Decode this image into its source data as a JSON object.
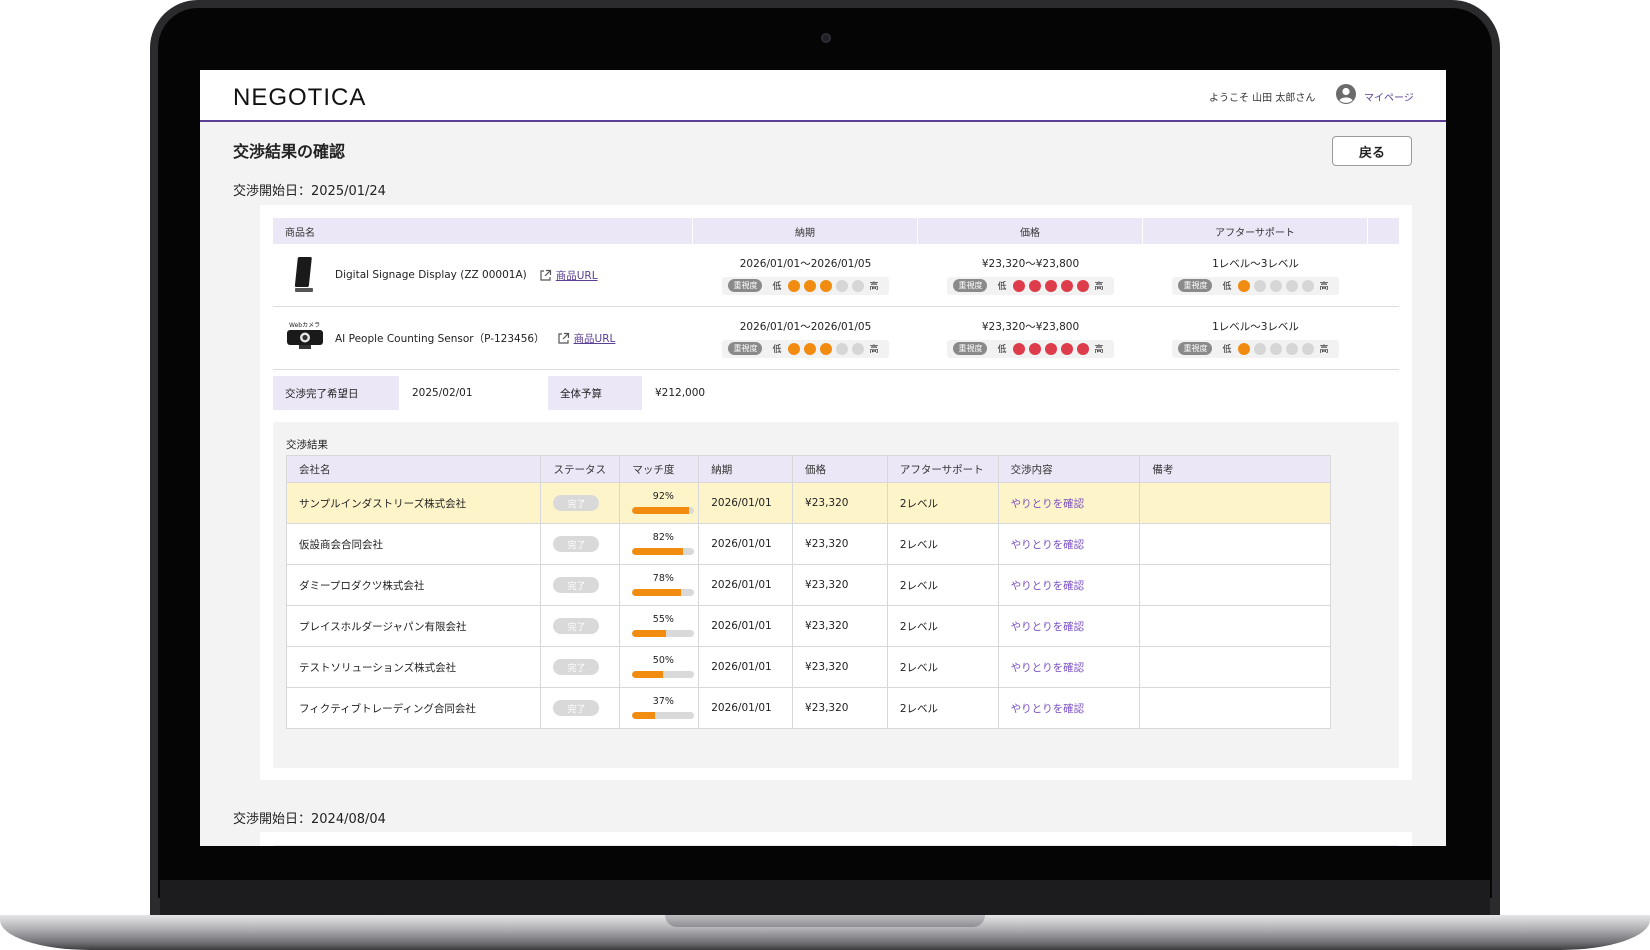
{
  "header": {
    "logo": "NEGOTICA",
    "welcome": "ようこそ 山田 太郎さん",
    "mypage": "マイページ"
  },
  "page": {
    "title": "交渉結果の確認",
    "back": "戻る"
  },
  "sections": [
    {
      "start_date": "交渉開始日：2025/01/24"
    },
    {
      "start_date": "交渉開始日：2024/08/04"
    }
  ],
  "products": {
    "headers": {
      "name": "商品名",
      "delivery": "納期",
      "price": "価格",
      "support": "アフターサポート"
    },
    "importance_badge": "重視度",
    "low": "低",
    "high": "高",
    "url_label": "商品URL",
    "items": [
      {
        "thumb": "display",
        "name": "Digital Signage Display (ZZ 00001A)",
        "delivery": "2026/01/01〜2026/01/05",
        "price": "¥23,320〜¥23,800",
        "support": "1レベル〜3レベル",
        "delivery_importance": 3,
        "price_importance": 5,
        "support_importance": 1
      },
      {
        "thumb": "webcam",
        "thumb_label": "Webカメラ",
        "name": "AI People Counting Sensor（P-123456）",
        "delivery": "2026/01/01〜2026/01/05",
        "price": "¥23,320〜¥23,800",
        "support": "1レベル〜3レベル",
        "delivery_importance": 3,
        "price_importance": 5,
        "support_importance": 1
      }
    ]
  },
  "info": {
    "deadline_label": "交渉完了希望日",
    "deadline_value": "2025/02/01",
    "budget_label": "全体予算",
    "budget_value": "¥212,000"
  },
  "results": {
    "title": "交渉結果",
    "headers": {
      "company": "会社名",
      "status": "ステータス",
      "match": "マッチ度",
      "delivery": "納期",
      "price": "価格",
      "support": "アフターサポート",
      "content": "交渉内容",
      "note": "備考"
    },
    "rows": [
      {
        "company": "サンプルインダストリーズ株式会社",
        "status": "完了",
        "match": 92,
        "match_label": "92%",
        "delivery": "2026/01/01",
        "price": "¥23,320",
        "support": "2レベル",
        "content": "やりとりを確認",
        "note": ""
      },
      {
        "company": "仮設商会合同会社",
        "status": "完了",
        "match": 82,
        "match_label": "82%",
        "delivery": "2026/01/01",
        "price": "¥23,320",
        "support": "2レベル",
        "content": "やりとりを確認",
        "note": ""
      },
      {
        "company": "ダミープロダクツ株式会社",
        "status": "完了",
        "match": 78,
        "match_label": "78%",
        "delivery": "2026/01/01",
        "price": "¥23,320",
        "support": "2レベル",
        "content": "やりとりを確認",
        "note": ""
      },
      {
        "company": "プレイスホルダージャパン有限会社",
        "status": "完了",
        "match": 55,
        "match_label": "55%",
        "delivery": "2026/01/01",
        "price": "¥23,320",
        "support": "2レベル",
        "content": "やりとりを確認",
        "note": ""
      },
      {
        "company": "テストソリューションズ株式会社",
        "status": "完了",
        "match": 50,
        "match_label": "50%",
        "delivery": "2026/01/01",
        "price": "¥23,320",
        "support": "2レベル",
        "content": "やりとりを確認",
        "note": ""
      },
      {
        "company": "フィクティブトレーディング合同会社",
        "status": "完了",
        "match": 37,
        "match_label": "37%",
        "delivery": "2026/01/01",
        "price": "¥23,320",
        "support": "2レベル",
        "content": "やりとりを確認",
        "note": ""
      }
    ]
  },
  "colors": {
    "brand": "#5b3f95",
    "accent_orange": "#f28c11",
    "accent_red": "#de3c4b",
    "highlight_row": "#fdf5c9",
    "header_bg": "#ece7f6"
  }
}
